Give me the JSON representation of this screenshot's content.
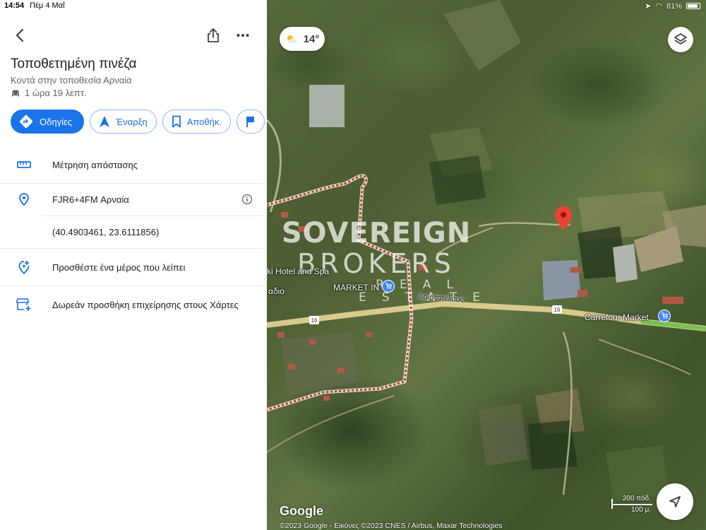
{
  "status_bar": {
    "time": "14:54",
    "date": "Πέμ 4 Μαΐ",
    "battery": "81%"
  },
  "place": {
    "title": "Τοποθετημένη πινέζα",
    "subtitle": "Κοντά στην τοποθεσία Αρναία",
    "drive_time": "1 ώρα 19 λεπτ."
  },
  "actions": {
    "directions": "Οδηγίες",
    "start": "Έναρξη",
    "save": "Αποθήκ."
  },
  "details": {
    "measure_distance": "Μέτρηση απόστασης",
    "plus_code": "FJR6+4FM Αρναία",
    "coordinates": "(40.4903461, 23.6111856)",
    "add_missing_place": "Προσθέστε ένα μέρος που λείπει",
    "add_business": "Δωρεάν προσθήκη επιχείρησης στους Χάρτες"
  },
  "map": {
    "temperature": "14°",
    "road_name": "Αριστοτέλους",
    "road_number": "16",
    "poi_carrefour": "Carrefour Market",
    "poi_market": "MARKET IN",
    "poi_hotel": "ki Hotel and Spa",
    "poi_small": "αδιο",
    "google": "Google",
    "copyright": "©2023 Google - Εικόνες ©2023 CNES / Airbus, Maxar Technologies",
    "scale_feet": "200 πόδ.",
    "scale_meters": "100 μ.",
    "watermark_line1": "SOVEREIGN",
    "watermark_line2": "BROKERS",
    "watermark_line3": "REAL ESTATE"
  },
  "colors": {
    "accent": "#1a73e8",
    "pin": "#ea4335"
  }
}
